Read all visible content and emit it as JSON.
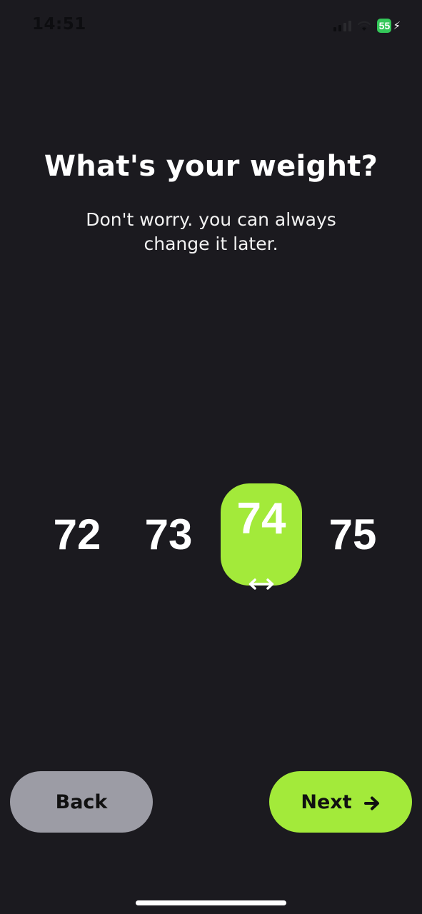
{
  "status_bar": {
    "time": "14:51",
    "battery": "55",
    "icons": [
      "signal-icon",
      "wifi-icon",
      "battery-icon",
      "charging-bolt-icon"
    ]
  },
  "header": {
    "title": "What's your weight?",
    "subtitle_line1": "Don't worry. you can always",
    "subtitle_line2": "change it later."
  },
  "picker": {
    "values": [
      "72",
      "73",
      "74",
      "75"
    ],
    "selected_value": "74",
    "selected_icon": "horizontal-arrows-icon",
    "accent_color": "#a3ea3a"
  },
  "buttons": {
    "back_label": "Back",
    "next_label": "Next",
    "next_icon": "arrow-right-icon",
    "back_color": "#9c9ca5",
    "next_color": "#a3ea3a"
  },
  "colors": {
    "background": "#1b1a1f",
    "text": "#ffffff"
  }
}
